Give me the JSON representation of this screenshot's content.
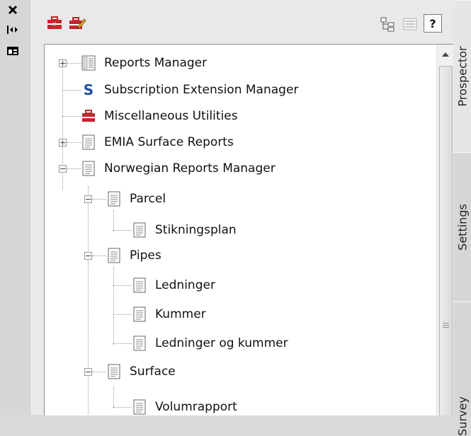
{
  "window": {
    "close_glyph": "✕",
    "autohide_glyph": "|◂▸",
    "menu_glyph": "▦"
  },
  "toolbar": {
    "icons": [
      "toolbox-icon",
      "edit-toolbox-icon",
      "tree-view-icon",
      "list-view-icon",
      "help-icon"
    ],
    "help_label": "?"
  },
  "tree": {
    "items": [
      {
        "label": "Reports Manager",
        "icon": "report-manager-icon"
      },
      {
        "label": "Subscription Extension Manager",
        "icon": "subscription-s-icon"
      },
      {
        "label": "Miscellaneous Utilities",
        "icon": "toolbox-icon"
      },
      {
        "label": "EMIA Surface Reports",
        "icon": "document-icon"
      },
      {
        "label": "Norwegian Reports Manager",
        "icon": "document-icon"
      },
      {
        "label": "Parcel",
        "icon": "document-icon"
      },
      {
        "label": "Stikningsplan",
        "icon": "document-icon"
      },
      {
        "label": "Pipes",
        "icon": "document-icon"
      },
      {
        "label": "Ledninger",
        "icon": "document-icon"
      },
      {
        "label": "Kummer",
        "icon": "document-icon"
      },
      {
        "label": "Ledninger og kummer",
        "icon": "document-icon"
      },
      {
        "label": "Surface",
        "icon": "document-icon"
      },
      {
        "label": "Volumrapport",
        "icon": "document-icon"
      }
    ]
  },
  "tabs": [
    {
      "label": "Prospector"
    },
    {
      "label": "Settings"
    },
    {
      "label": "Survey"
    }
  ],
  "colors": {
    "toolbox_red": "#c8232c",
    "subscription_blue": "#1f4e9a"
  }
}
